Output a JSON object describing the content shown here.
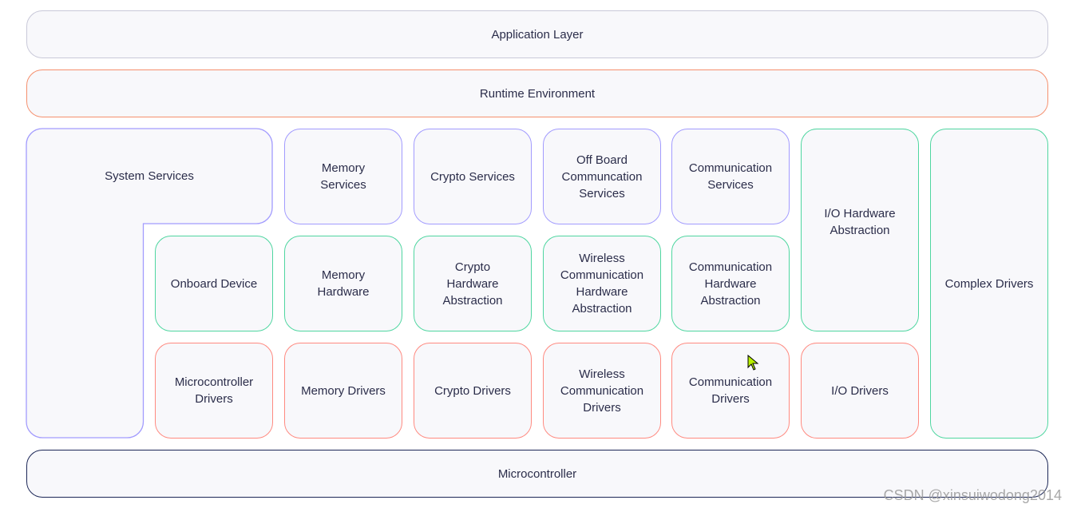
{
  "colors": {
    "services_border": "#a29bfe",
    "abstraction_border": "#4fd6a0",
    "drivers_border": "#ff8a80",
    "runtime_border": "#f5906e",
    "application_border": "#c9c9d9",
    "microcontroller_border": "#1c2757",
    "box_fill": "#f8f8fb"
  },
  "layers": {
    "application": "Application Layer",
    "runtime": "Runtime Environment",
    "microcontroller": "Microcontroller"
  },
  "services_row": {
    "system_services": "System Services",
    "memory_services": "Memory\nServices",
    "crypto_services": "Crypto Services",
    "offboard_services": "Off Board\nCommuncation\nServices",
    "communication_services": "Communication\nServices"
  },
  "abstraction_row": {
    "onboard_device": "Onboard Device",
    "memory_hardware": "Memory\nHardware",
    "crypto_hw_abstraction": "Crypto\nHardware\nAbstraction",
    "wireless_hw_abstraction": "Wireless\nCommunication\nHardware\nAbstraction",
    "communication_hw_abstraction": "Communication\nHardware\nAbstraction",
    "io_hw_abstraction": "I/O Hardware\nAbstraction"
  },
  "drivers_row": {
    "microcontroller_drivers": "Microcontroller\nDrivers",
    "memory_drivers": "Memory Drivers",
    "crypto_drivers": "Crypto Drivers",
    "wireless_drivers": "Wireless\nCommunication\nDrivers",
    "communication_drivers": "Communication\nDrivers",
    "io_drivers": "I/O Drivers"
  },
  "complex_drivers": "Complex Drivers",
  "watermark": "CSDN @xinsuiwodong2014",
  "cursor_icon": "mouse-pointer-icon"
}
